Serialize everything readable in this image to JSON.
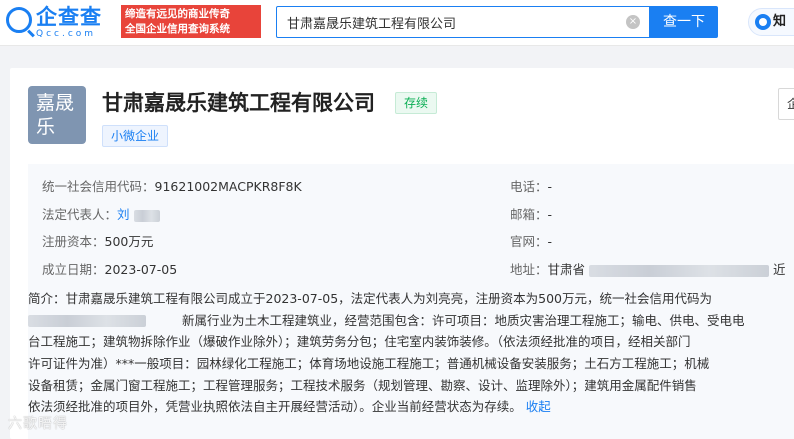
{
  "header": {
    "logo_text": "企查查",
    "logo_sub": "Qcc.com",
    "slogan_line1": "缔造有远见的商业传奇",
    "slogan_line2": "全国企业信用查询系统",
    "search_value": "甘肃嘉晟乐建筑工程有限公司",
    "clear_symbol": "×",
    "search_button": "查一下",
    "know_label": "知"
  },
  "company": {
    "avatar_text": "嘉晟乐",
    "name": "甘肃嘉晟乐建筑工程有限公司",
    "status": "存续",
    "scale_tag": "小微企业",
    "side_button": "企"
  },
  "info": {
    "credit_code_label": "统一社会信用代码：",
    "credit_code": "91621002MACPKR8F8K",
    "legal_rep_label": "法定代表人：",
    "legal_rep": "刘",
    "capital_label": "注册资本：",
    "capital": "500万元",
    "founded_label": "成立日期：",
    "founded": "2023-07-05",
    "phone_label": "电话：",
    "phone": "-",
    "email_label": "邮箱：",
    "email": "-",
    "website_label": "官网：",
    "website": "-",
    "address_label": "地址：",
    "address": "甘肃省",
    "address_tail": "近"
  },
  "intro": {
    "line1": "简介：甘肃嘉晟乐建筑工程有限公司成立于2023-07-05，法定代表人为刘亮亮，注册资本为500万元，统一社会信用代码为",
    "line2": "新属行业为土木工程建筑业，经营范围包含：许可项目：地质灾害治理工程施工；输电、供电、受电电",
    "line3": "台工程施工；建筑物拆除作业（爆破作业除外）；建筑劳务分包；住宅室内装饰装修。（依法须经批准的项目，经相关部门",
    "line4": "许可证件为准）***一般项目：园林绿化工程施工；体育场地设施工程施工；普通机械设备安装服务；土石方工程施工；机械",
    "line5": "设备租赁；金属门窗工程施工；工程管理服务；工程技术服务（规划管理、勘察、设计、监理除外）；建筑用金属配件销售",
    "line6": "依法须经批准的项目外，凭营业执照依法自主开展经营活动）。企业当前经营状态为存续。",
    "collapse": "收起"
  },
  "watermark": "六歌晤得"
}
